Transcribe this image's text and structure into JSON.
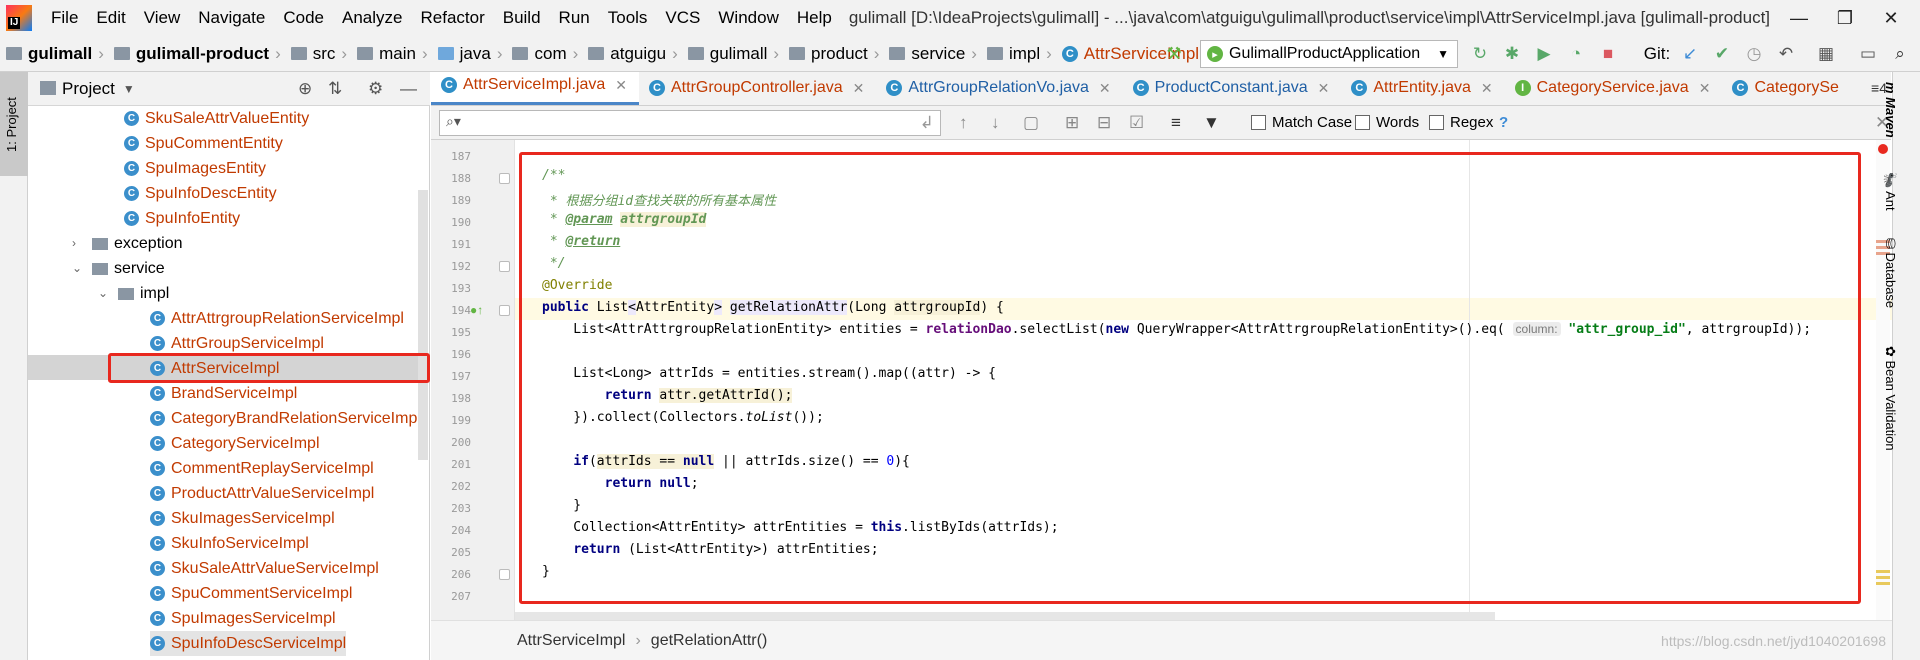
{
  "menubar": {
    "items": [
      "File",
      "Edit",
      "View",
      "Navigate",
      "Code",
      "Analyze",
      "Refactor",
      "Build",
      "Run",
      "Tools",
      "VCS",
      "Window",
      "Help"
    ],
    "title": "gulimall [D:\\IdeaProjects\\gulimall] - ...\\java\\com\\atguigu\\gulimall\\product\\service\\impl\\AttrServiceImpl.java [gulimall-product]"
  },
  "navbar": {
    "crumbs": [
      "gulimall",
      "gulimall-product",
      "src",
      "main",
      "java",
      "com",
      "atguigu",
      "gulimall",
      "product",
      "service",
      "impl",
      "AttrServiceImpl"
    ],
    "run_config": "GulimallProductApplication",
    "git_label": "Git:"
  },
  "project": {
    "header": "Project",
    "tab_label": "1: Project",
    "rows": [
      {
        "name": "SkuSaleAttrValueEntity",
        "kind": "class"
      },
      {
        "name": "SpuCommentEntity",
        "kind": "class"
      },
      {
        "name": "SpuImagesEntity",
        "kind": "class"
      },
      {
        "name": "SpuInfoDescEntity",
        "kind": "class"
      },
      {
        "name": "SpuInfoEntity",
        "kind": "class"
      },
      {
        "name": "exception",
        "kind": "folder"
      },
      {
        "name": "service",
        "kind": "folder"
      },
      {
        "name": "impl",
        "kind": "folder"
      },
      {
        "name": "AttrAttrgroupRelationServiceImpl",
        "kind": "class"
      },
      {
        "name": "AttrGroupServiceImpl",
        "kind": "class"
      },
      {
        "name": "AttrServiceImpl",
        "kind": "class"
      },
      {
        "name": "BrandServiceImpl",
        "kind": "class"
      },
      {
        "name": "CategoryBrandRelationServiceImpl",
        "kind": "class"
      },
      {
        "name": "CategoryServiceImpl",
        "kind": "class"
      },
      {
        "name": "CommentReplayServiceImpl",
        "kind": "class"
      },
      {
        "name": "ProductAttrValueServiceImpl",
        "kind": "class"
      },
      {
        "name": "SkuImagesServiceImpl",
        "kind": "class"
      },
      {
        "name": "SkuInfoServiceImpl",
        "kind": "class"
      },
      {
        "name": "SkuSaleAttrValueServiceImpl",
        "kind": "class"
      },
      {
        "name": "SpuCommentServiceImpl",
        "kind": "class"
      },
      {
        "name": "SpuImagesServiceImpl",
        "kind": "class"
      },
      {
        "name": "SpuInfoDescServiceImpl",
        "kind": "class"
      }
    ]
  },
  "editor_tabs": [
    "AttrServiceImpl.java",
    "AttrGroupController.java",
    "AttrGroupRelationVo.java",
    "ProductConstant.java",
    "AttrEntity.java",
    "CategoryService.java",
    "CategorySe"
  ],
  "editor_tabs_overflow": "≡4",
  "search": {
    "match_case": "Match Case",
    "words": "Words",
    "regex": "Regex",
    "help": "?"
  },
  "code": {
    "line_numbers": [
      "187",
      "188",
      "189",
      "190",
      "191",
      "192",
      "193",
      "194",
      "195",
      "196",
      "197",
      "198",
      "199",
      "200",
      "201",
      "202",
      "203",
      "204",
      "205",
      "206",
      "207"
    ],
    "comment_open": "/**",
    "comment_desc": " * 根据分组id查找关联的所有基本属性",
    "param_tag": "@param",
    "param_name": "attrgroupId",
    "return_tag": "@return",
    "comment_close": " */",
    "annotation": "@Override",
    "hint_column": "column:",
    "string_attr_group_id": "\"attr_group_id\""
  },
  "right_strip": [
    "Maven",
    "Ant",
    "Database",
    "Bean Validation"
  ],
  "breadcrumb": {
    "class_name": "AttrServiceImpl",
    "method_name": "getRelationAttr()"
  },
  "watermark": "https://blog.csdn.net/jyd1040201698"
}
